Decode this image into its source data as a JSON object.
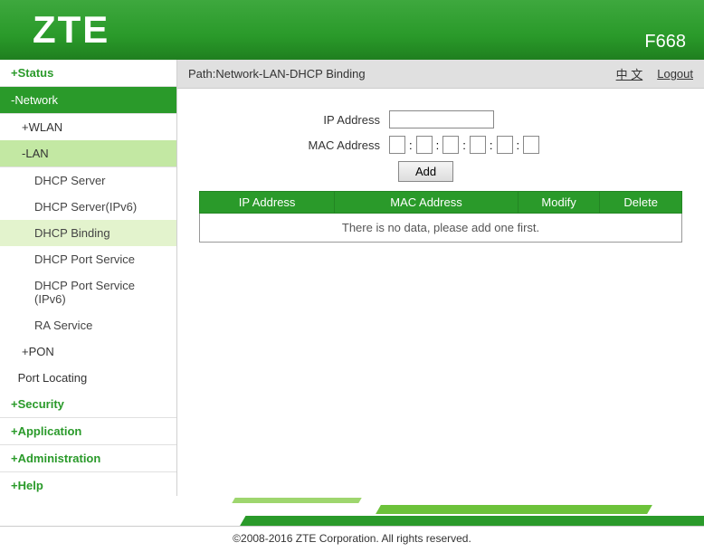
{
  "header": {
    "logo": "ZTE",
    "model": "F668"
  },
  "pathbar": {
    "path": "Path:Network-LAN-DHCP Binding",
    "lang": "中 文",
    "logout": "Logout"
  },
  "nav": {
    "status": "Status",
    "network": "Network",
    "wlan": "WLAN",
    "lan": "LAN",
    "dhcp_server": "DHCP Server",
    "dhcp_server_ipv6": "DHCP Server(IPv6)",
    "dhcp_binding": "DHCP Binding",
    "dhcp_port_service": "DHCP Port Service",
    "dhcp_port_service_ipv6": "DHCP Port Service (IPv6)",
    "ra_service": "RA Service",
    "pon": "PON",
    "port_locating": "Port Locating",
    "security": "Security",
    "application": "Application",
    "administration": "Administration",
    "help": "Help"
  },
  "form": {
    "ip_label": "IP Address",
    "mac_label": "MAC Address",
    "add_btn": "Add"
  },
  "table": {
    "headers": {
      "ip": "IP Address",
      "mac": "MAC Address",
      "modify": "Modify",
      "delete": "Delete"
    },
    "empty": "There is no data, please add one first."
  },
  "footer": "©2008-2016 ZTE Corporation. All rights reserved.",
  "help_icon": "?"
}
